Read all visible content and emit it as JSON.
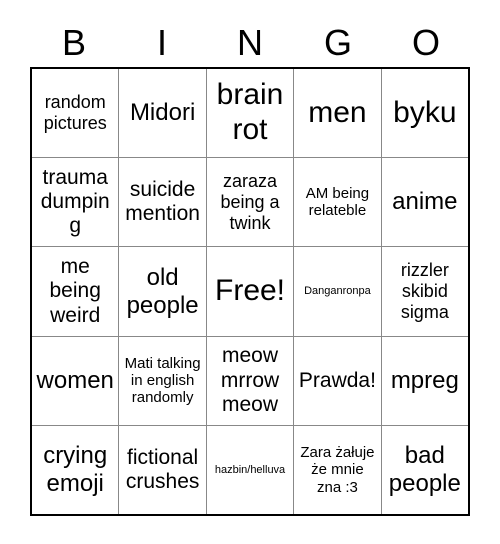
{
  "card": {
    "header": {
      "letters": [
        "B",
        "I",
        "N",
        "G",
        "O"
      ]
    },
    "rows": [
      {
        "cells": [
          {
            "text": "random pictures",
            "size": "sm"
          },
          {
            "text": "Midori",
            "size": "lg"
          },
          {
            "text": "brain rot",
            "size": "xl"
          },
          {
            "text": "men",
            "size": "xl"
          },
          {
            "text": "byku",
            "size": "xl"
          }
        ]
      },
      {
        "cells": [
          {
            "text": "trauma dumping",
            "size": "md"
          },
          {
            "text": "suicide mention",
            "size": "md"
          },
          {
            "text": "zaraza being a twink",
            "size": "sm"
          },
          {
            "text": "AM being relateble",
            "size": "xs"
          },
          {
            "text": "anime",
            "size": "lg"
          }
        ]
      },
      {
        "cells": [
          {
            "text": "me being weird",
            "size": "md"
          },
          {
            "text": "old people",
            "size": "lg"
          },
          {
            "text": "Free!",
            "size": "xl"
          },
          {
            "text": "Danganronpa",
            "size": "xxs"
          },
          {
            "text": "rizzler skibid sigma",
            "size": "sm"
          }
        ]
      },
      {
        "cells": [
          {
            "text": "women",
            "size": "lg"
          },
          {
            "text": "Mati talking in english randomly",
            "size": "xs"
          },
          {
            "text": "meow mrrow meow",
            "size": "md"
          },
          {
            "text": "Prawda!",
            "size": "md"
          },
          {
            "text": "mpreg",
            "size": "lg"
          }
        ]
      },
      {
        "cells": [
          {
            "text": "crying emoji",
            "size": "lg"
          },
          {
            "text": "fictional crushes",
            "size": "md"
          },
          {
            "text": "hazbin/helluva",
            "size": "xxs"
          },
          {
            "text": "Zara żałuje że mnie zna :3",
            "size": "xs"
          },
          {
            "text": "bad people",
            "size": "lg"
          }
        ]
      }
    ]
  },
  "colors": {
    "outer_border": "#000000",
    "inner_border": "#888888",
    "background": "#ffffff",
    "text": "#000000"
  }
}
